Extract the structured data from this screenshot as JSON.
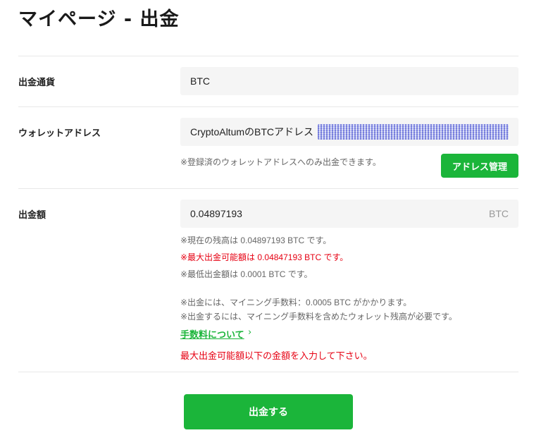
{
  "page": {
    "title": "マイページ - 出金"
  },
  "currency": {
    "label": "出金通貨",
    "value": "BTC"
  },
  "wallet": {
    "label": "ウォレットアドレス",
    "value_prefix": "CryptoAltumのBTCアドレス",
    "note": "※登録済のウォレットアドレスへのみ出金できます。",
    "manage_button": "アドレス管理"
  },
  "amount": {
    "label": "出金額",
    "value": "0.04897193",
    "unit": "BTC",
    "notes": {
      "balance": "※現在の残高は 0.04897193 BTC です。",
      "max": "※最大出金可能額は 0.04847193 BTC です。",
      "min": "※最低出金額は 0.0001 BTC です。",
      "fee": "※出金には、マイニング手数料：0.0005 BTC がかかります。",
      "fee_balance": "※出金するには、マイニング手数料を含めたウォレット残高が必要です。"
    },
    "fee_link": "手数料について",
    "error": "最大出金可能額以下の金額を入力して下さい。"
  },
  "submit": {
    "label": "出金する"
  },
  "colors": {
    "accent": "#1bb53a",
    "error": "#e60012",
    "field_bg": "#f5f5f5"
  }
}
